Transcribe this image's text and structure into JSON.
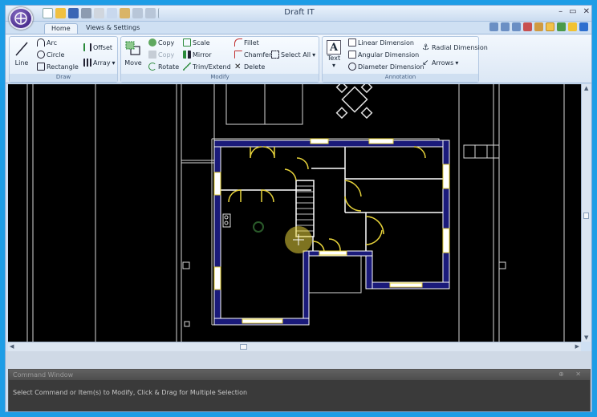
{
  "window": {
    "title": "Draft IT",
    "controls": [
      "–",
      "▭",
      "✕"
    ]
  },
  "tabs": [
    {
      "label": "Home",
      "active": true
    },
    {
      "label": "Views & Settings",
      "active": false
    }
  ],
  "ribbon": {
    "draw": {
      "label": "Draw",
      "line": "Line",
      "arc": "Arc",
      "circle": "Circle",
      "rectangle": "Rectangle",
      "offset": "Offset",
      "array": "Array"
    },
    "modify": {
      "label": "Modify",
      "move": "Move",
      "copy": "Copy",
      "copy_disabled": "Copy",
      "rotate": "Rotate",
      "scale": "Scale",
      "mirror": "Mirror",
      "trim_extend": "Trim/Extend",
      "fillet": "Fillet",
      "chamfer": "Chamfer",
      "delete": "Delete",
      "select_all": "Select All"
    },
    "annotation": {
      "label": "Annotation",
      "text": "Text",
      "linear_dimension": "Linear Dimension",
      "angular_dimension": "Angular Dimension",
      "diameter_dimension": "Diameter Dimension",
      "radial_dimension": "Radial Dimension",
      "arrows": "Arrows"
    }
  },
  "command_window": {
    "title": "Command Window",
    "controls": "⊕ ✕",
    "prompt": "Select Command or Item(s) to Modify, Click & Drag for Multiple Selection"
  },
  "colors": {
    "accent": "#1e9de6",
    "canvas": "#000000",
    "wall_fill": "#1a1a7a",
    "door_yellow": "#e6d23a"
  }
}
